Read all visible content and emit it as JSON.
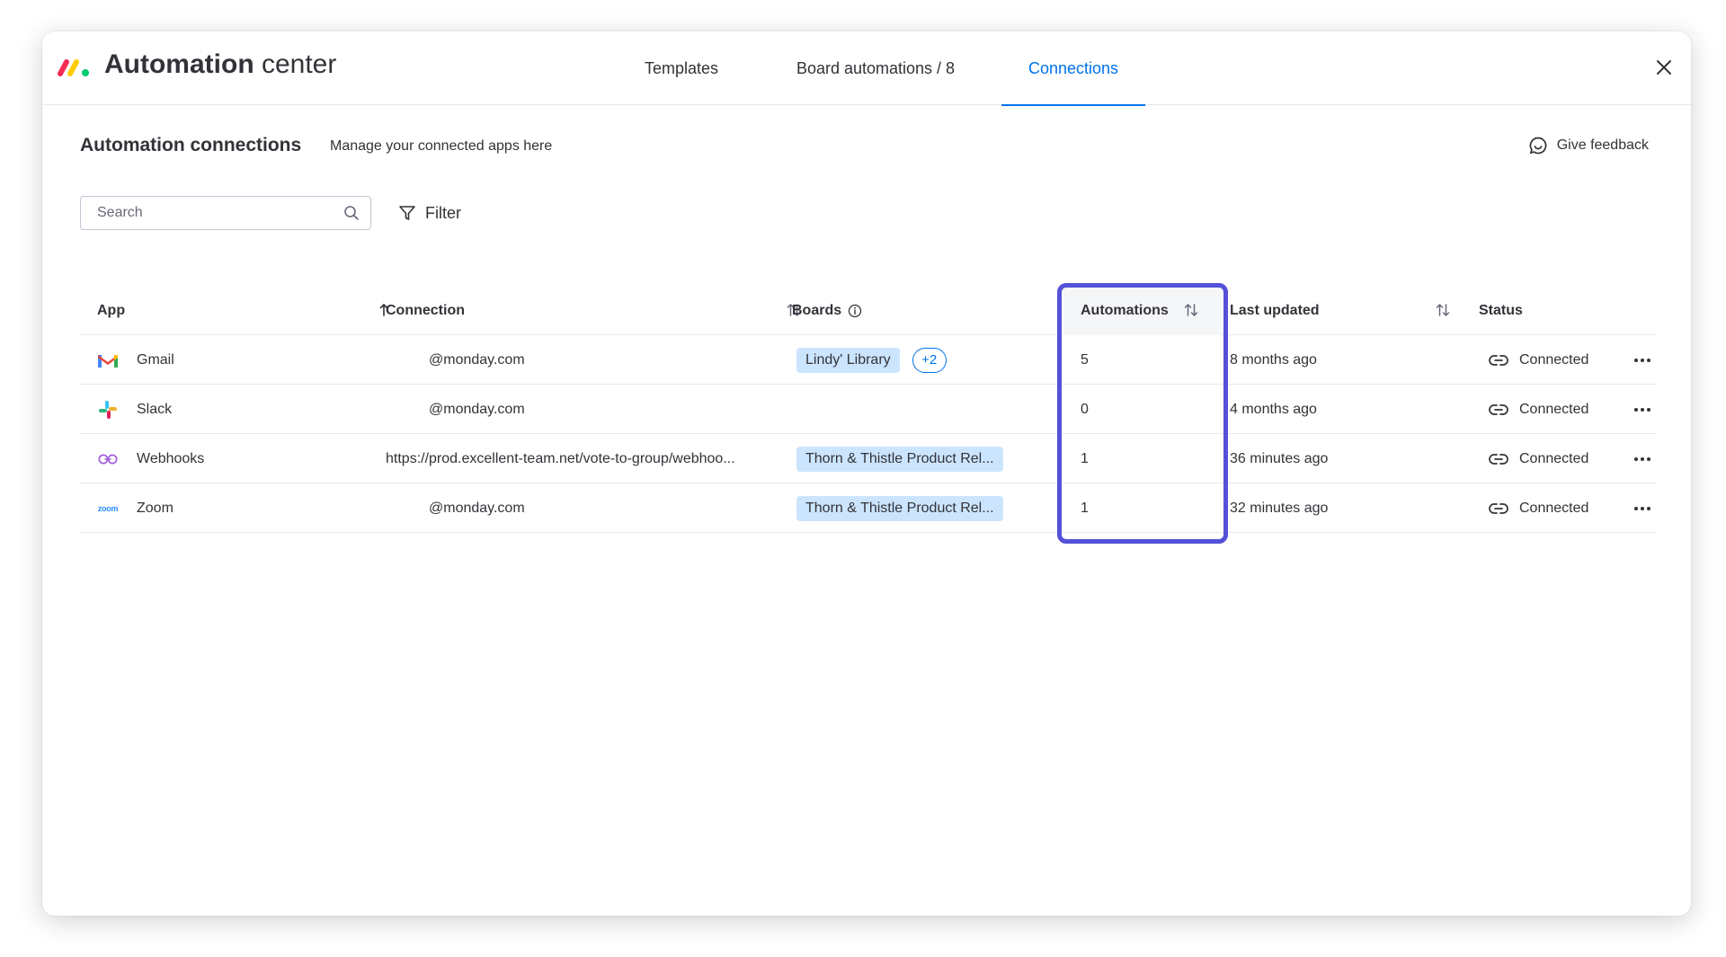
{
  "header": {
    "title_bold": "Automation",
    "title_light": " center",
    "tabs": [
      {
        "label": "Templates",
        "active": false
      },
      {
        "label": "Board automations / 8",
        "active": false
      },
      {
        "label": "Connections",
        "active": true
      }
    ]
  },
  "page": {
    "title": "Automation connections",
    "subtitle": "Manage your connected apps here",
    "feedback_label": "Give feedback"
  },
  "toolbar": {
    "search_placeholder": "Search",
    "filter_label": "Filter"
  },
  "table": {
    "columns": {
      "app": "App",
      "connection": "Connection",
      "boards": "Boards",
      "automations": "Automations",
      "last_updated": "Last updated",
      "status": "Status"
    },
    "rows": [
      {
        "app": "Gmail",
        "icon": "gmail-icon",
        "connection": "@monday.com",
        "board": "Lindy' Library",
        "board_more": "+2",
        "automations": "5",
        "last_updated": "8 months ago",
        "status": "Connected"
      },
      {
        "app": "Slack",
        "icon": "slack-icon",
        "connection": "@monday.com",
        "board": "",
        "board_more": "",
        "automations": "0",
        "last_updated": "4 months ago",
        "status": "Connected"
      },
      {
        "app": "Webhooks",
        "icon": "webhooks-icon",
        "connection": "https://prod.excellent-team.net/vote-to-group/webhoo...",
        "board": "Thorn & Thistle Product Rel...",
        "board_more": "",
        "automations": "1",
        "last_updated": "36 minutes ago",
        "status": "Connected"
      },
      {
        "app": "Zoom",
        "icon": "zoom-icon",
        "connection": "@monday.com",
        "board": "Thorn & Thistle Product Rel...",
        "board_more": "",
        "automations": "1",
        "last_updated": "32 minutes ago",
        "status": "Connected"
      }
    ]
  },
  "colors": {
    "accent": "#0073ea",
    "highlight": "#5551d9",
    "tag_bg": "#cce5ff"
  },
  "icons": {
    "zoom_text": "zoom"
  }
}
